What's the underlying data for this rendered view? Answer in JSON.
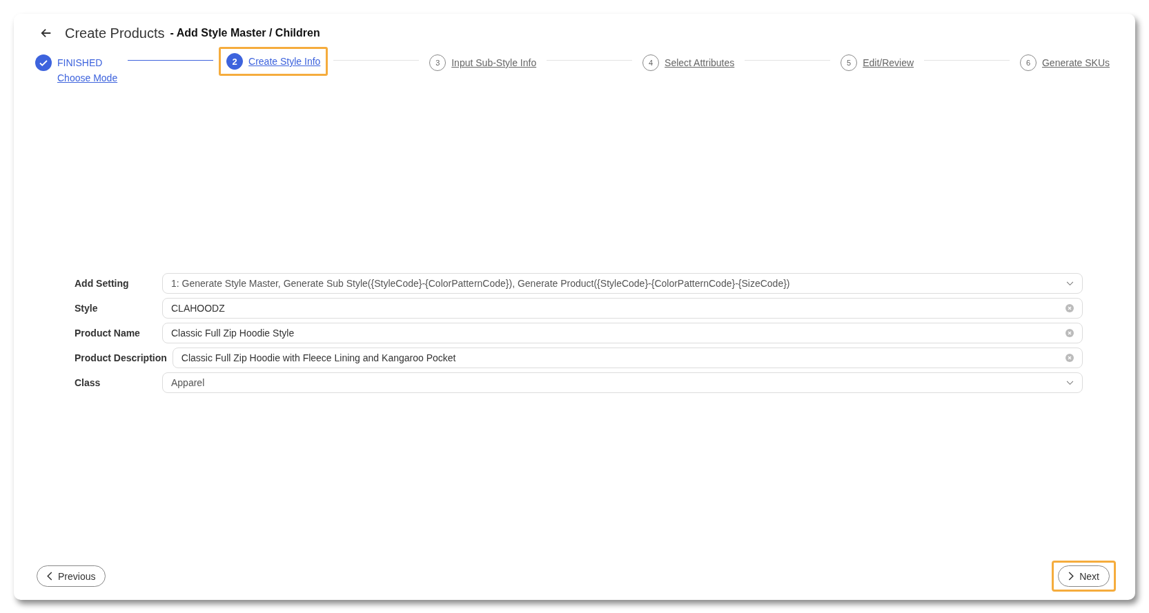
{
  "header": {
    "title": "Create Products",
    "subtitle": "- Add Style Master / Children"
  },
  "steps": [
    {
      "kind": "finished",
      "label": "FINISHED",
      "link": "Choose Mode",
      "selected": false,
      "highlighted": false
    },
    {
      "kind": "active",
      "number": "2",
      "label": "Create Style Info",
      "selected": true,
      "highlighted": true
    },
    {
      "kind": "pending",
      "number": "3",
      "label": "Input Sub-Style Info",
      "selected": false,
      "highlighted": false
    },
    {
      "kind": "pending",
      "number": "4",
      "label": "Select Attributes",
      "selected": false,
      "highlighted": false
    },
    {
      "kind": "pending",
      "number": "5",
      "label": "Edit/Review",
      "selected": false,
      "highlighted": false
    },
    {
      "kind": "pending",
      "number": "6",
      "label": "Generate SKUs",
      "selected": false,
      "highlighted": false
    }
  ],
  "form": [
    {
      "kind": "select",
      "label": "Add Setting",
      "value": "1: Generate Style Master, Generate Sub Style({StyleCode}-{ColorPatternCode}), Generate Product({StyleCode}-{ColorPatternCode}-{SizeCode})"
    },
    {
      "kind": "text",
      "label": "Style",
      "value": "CLAHOODZ"
    },
    {
      "kind": "text",
      "label": "Product Name",
      "value": "Classic Full Zip Hoodie Style"
    },
    {
      "kind": "text",
      "label": "Product Description",
      "value": "Classic Full Zip Hoodie with Fleece Lining and Kangaroo Pocket"
    },
    {
      "kind": "select",
      "label": "Class",
      "value": "Apparel"
    }
  ],
  "buttons": [
    {
      "kind": "previous",
      "label": "Previous",
      "highlighted": false
    },
    {
      "kind": "next",
      "label": "Next",
      "highlighted": true
    }
  ]
}
